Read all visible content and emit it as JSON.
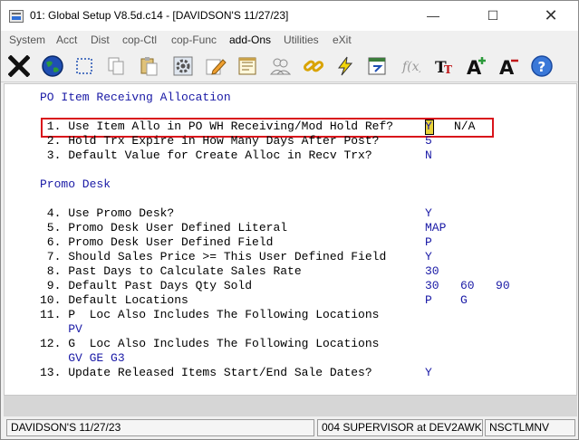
{
  "window": {
    "title": "01: Global Setup V8.5d.c14 - [DAVIDSON'S 11/27/23]",
    "minimize_glyph": "—",
    "maximize_glyph": "☐",
    "close_glyph": "✕"
  },
  "menu": [
    {
      "label": "System"
    },
    {
      "label": "Acct"
    },
    {
      "label": "Dist"
    },
    {
      "label": "cop-Ctl"
    },
    {
      "label": "cop-Func"
    },
    {
      "label": "add-Ons"
    },
    {
      "label": "Utilities"
    },
    {
      "label": "eXit"
    }
  ],
  "toolbar_icons": [
    "close-x-icon",
    "globe-icon",
    "select-box-icon",
    "copy-icon",
    "paste-icon",
    "settings-gear-icon",
    "edit-pencil-icon",
    "notepad-icon",
    "users-icon",
    "chain-link-icon",
    "lightning-icon",
    "calendar-icon",
    "function-icon",
    "font-icon",
    "font-increase-icon",
    "font-decrease-icon",
    "help-icon"
  ],
  "screen": {
    "section1_title": "PO Item Receivng Allocation",
    "section2_title": "Promo Desk",
    "rows": [
      {
        "label": " 1. Use Item Allo in PO WH Receiving/Mod Hold Ref?",
        "value": "Y",
        "extra": "N/A"
      },
      {
        "label": " 2. Hold Trx Expire in How Many Days After Post?",
        "value": "5"
      },
      {
        "label": " 3. Default Value for Create Alloc in Recv Trx?",
        "value": "N"
      },
      {
        "label": " 4. Use Promo Desk?",
        "value": "Y"
      },
      {
        "label": " 5. Promo Desk User Defined Literal",
        "value": "MAP"
      },
      {
        "label": " 6. Promo Desk User Defined Field",
        "value": "P"
      },
      {
        "label": " 7. Should Sales Price >= This User Defined Field",
        "value": "Y"
      },
      {
        "label": " 8. Past Days to Calculate Sales Rate",
        "value": "30"
      },
      {
        "label": " 9. Default Past Days Qty Sold",
        "value": "30   60   90"
      },
      {
        "label": "10. Default Locations",
        "value": "P    G"
      },
      {
        "label": "11. P  Loc Also Includes The Following Locations",
        "value": ""
      },
      {
        "label": "    PV",
        "value": ""
      },
      {
        "label": "12. G  Loc Also Includes The Following Locations",
        "value": ""
      },
      {
        "label": "    GV GE G3",
        "value": ""
      },
      {
        "label": "13. Update Released Items Start/End Sale Dates?",
        "value": "Y"
      }
    ]
  },
  "status": {
    "company": "DAVIDSON'S 11/27/23",
    "user": "004 SUPERVISOR at DEV2AWK",
    "terminal": "NSCTLMNV"
  }
}
